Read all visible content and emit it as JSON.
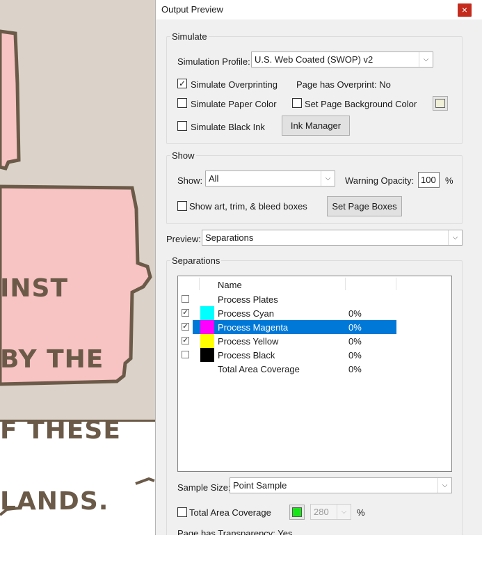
{
  "window": {
    "title": "Output Preview"
  },
  "title_bar": {
    "close_glyph": "×"
  },
  "background": {
    "comic_lines": [
      "INST",
      "BY THE",
      "F THESE",
      "LANDS."
    ]
  },
  "simulate": {
    "group_label": "Simulate",
    "profile_label": "Simulation Profile:",
    "profile_value": "U.S. Web Coated (SWOP) v2",
    "overprinting_label": "Simulate Overprinting",
    "overprinting_checked": true,
    "overprint_status": "Page has Overprint:  No",
    "paper_color_label": "Simulate Paper Color",
    "paper_color_checked": false,
    "page_bg_label": "Set Page Background Color",
    "page_bg_checked": false,
    "page_bg_swatch_color": "#f0efd8",
    "black_ink_label": "Simulate Black Ink",
    "black_ink_checked": false,
    "ink_manager_label": "Ink Manager"
  },
  "show": {
    "group_label": "Show",
    "show_label": "Show:",
    "show_value": "All",
    "warning_label": "Warning Opacity:",
    "warning_value": "100",
    "warning_unit": "%",
    "boxes_label": "Show art, trim, & bleed boxes",
    "boxes_checked": false,
    "set_page_boxes_label": "Set Page Boxes"
  },
  "preview": {
    "label": "Preview:",
    "value": "Separations"
  },
  "separations": {
    "group_label": "Separations",
    "header_name": "Name",
    "rows": [
      {
        "name": "Process Plates",
        "checked": false,
        "has_checkbox": true,
        "swatch": "",
        "pct": ""
      },
      {
        "name": "Process Cyan",
        "checked": true,
        "has_checkbox": true,
        "swatch": "#00ffff",
        "pct": "0%"
      },
      {
        "name": "Process Magenta",
        "checked": true,
        "has_checkbox": true,
        "swatch": "#ff00ff",
        "pct": "0%",
        "selected": true
      },
      {
        "name": "Process Yellow",
        "checked": true,
        "has_checkbox": true,
        "swatch": "#ffff00",
        "pct": "0%"
      },
      {
        "name": "Process Black",
        "checked": false,
        "has_checkbox": true,
        "swatch": "#000000",
        "pct": "0%"
      },
      {
        "name": "Total Area Coverage",
        "checked": false,
        "has_checkbox": false,
        "swatch": "",
        "pct": "0%"
      }
    ]
  },
  "sample": {
    "label": "Sample Size:",
    "value": "Point Sample"
  },
  "coverage": {
    "label": "Total Area Coverage",
    "checked": false,
    "swatch_color": "#19e619",
    "value": "280",
    "unit": "%"
  },
  "transparency": {
    "text": "Page has Transparency:  Yes"
  },
  "colors": {
    "selection": "#0078d7",
    "close_button": "#c42b1c",
    "comic_pink": "#f7c3c3",
    "comic_bg": "#dbd3c9",
    "comic_outline": "#6b5a48"
  }
}
